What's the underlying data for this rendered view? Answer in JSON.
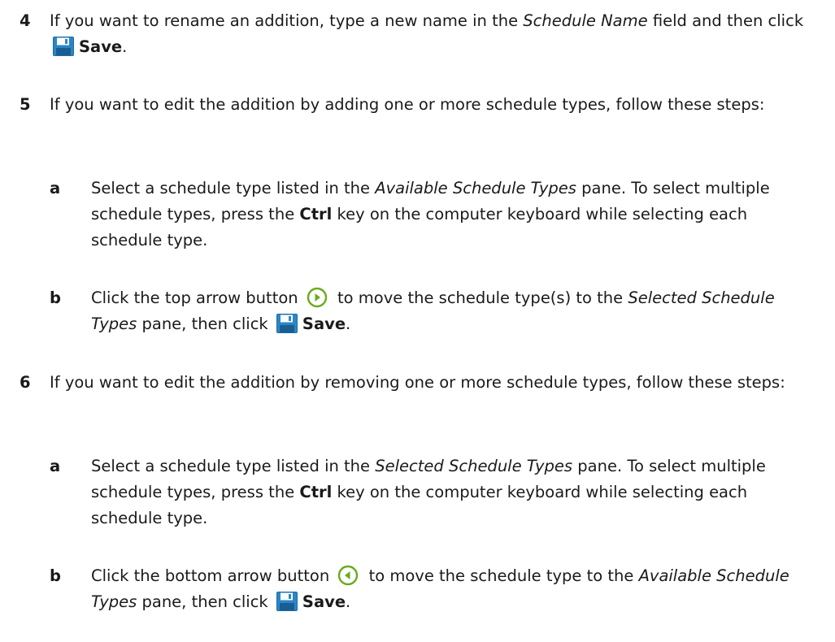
{
  "steps": [
    {
      "number": "4",
      "t1": "If you want to rename an addition, type a new name in the ",
      "em1": "Schedule Name",
      "t2": " field and then click ",
      "save_label": "Save",
      "t3": "."
    },
    {
      "number": "5",
      "text": "If you want to edit the addition by adding one or more schedule types, follow these steps:",
      "substeps": [
        {
          "letter": "a",
          "t1": "Select a schedule type listed in the ",
          "em1": "Available Schedule Types",
          "t2": " pane. To select multiple schedule types, press the ",
          "key": "Ctrl",
          "t3": " key on the computer keyboard while selecting each schedule type."
        },
        {
          "letter": "b",
          "t1": "Click the top arrow button ",
          "t2": " to move the schedule type(s) to the ",
          "em1": "Selected Schedule Types",
          "t3": " pane, then click ",
          "save_label": "Save",
          "t4": "."
        }
      ]
    },
    {
      "number": "6",
      "text": "If you want to edit the addition by removing one or more schedule types, follow these steps:",
      "substeps": [
        {
          "letter": "a",
          "t1": "Select a schedule type listed in the ",
          "em1": "Selected Schedule Types",
          "t2": " pane. To select multiple schedule types, press the ",
          "key": "Ctrl",
          "t3": " key on the computer keyboard while selecting each schedule type."
        },
        {
          "letter": "b",
          "t1": "Click the bottom arrow button ",
          "t2": " to move the schedule type to the ",
          "em1": "Available Schedule Types",
          "t3": " pane, then click ",
          "save_label": "Save",
          "t4": "."
        }
      ]
    }
  ],
  "icons": {
    "save": "save-icon",
    "arrow_right": "arrow-right-icon",
    "arrow_left": "arrow-left-icon"
  },
  "colors": {
    "save_icon": "#2a86c8",
    "arrow_icon": "#6aaa1e"
  }
}
